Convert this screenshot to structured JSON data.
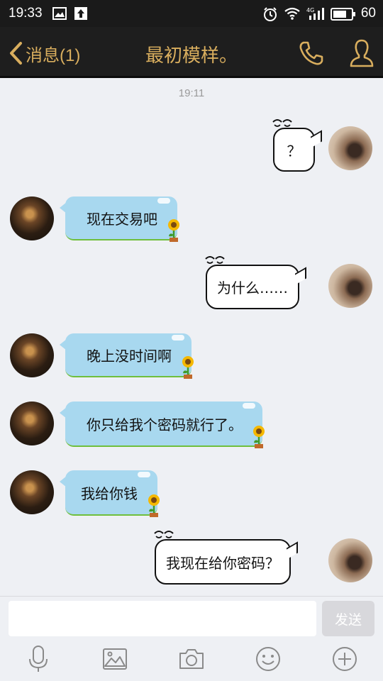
{
  "status_bar": {
    "time": "19:33",
    "battery": "60",
    "network": "4G"
  },
  "header": {
    "back_label": "消息(1)",
    "title": "最初模样。",
    "accent_color": "#d9ae5e"
  },
  "chat": {
    "timestamp": "19:11",
    "messages": [
      {
        "side": "out",
        "text": "？"
      },
      {
        "side": "in",
        "text": "现在交易吧"
      },
      {
        "side": "out",
        "text": "为什么……"
      },
      {
        "side": "in",
        "text": "晚上没时间啊"
      },
      {
        "side": "in",
        "text": "你只给我个密码就行了。"
      },
      {
        "side": "in",
        "text": "我给你钱"
      },
      {
        "side": "out",
        "text": "我现在给你密码？"
      }
    ]
  },
  "input_bar": {
    "placeholder": "",
    "send_label": "发送",
    "tools": [
      "microphone-icon",
      "image-icon",
      "camera-icon",
      "emoji-icon",
      "plus-icon"
    ]
  }
}
